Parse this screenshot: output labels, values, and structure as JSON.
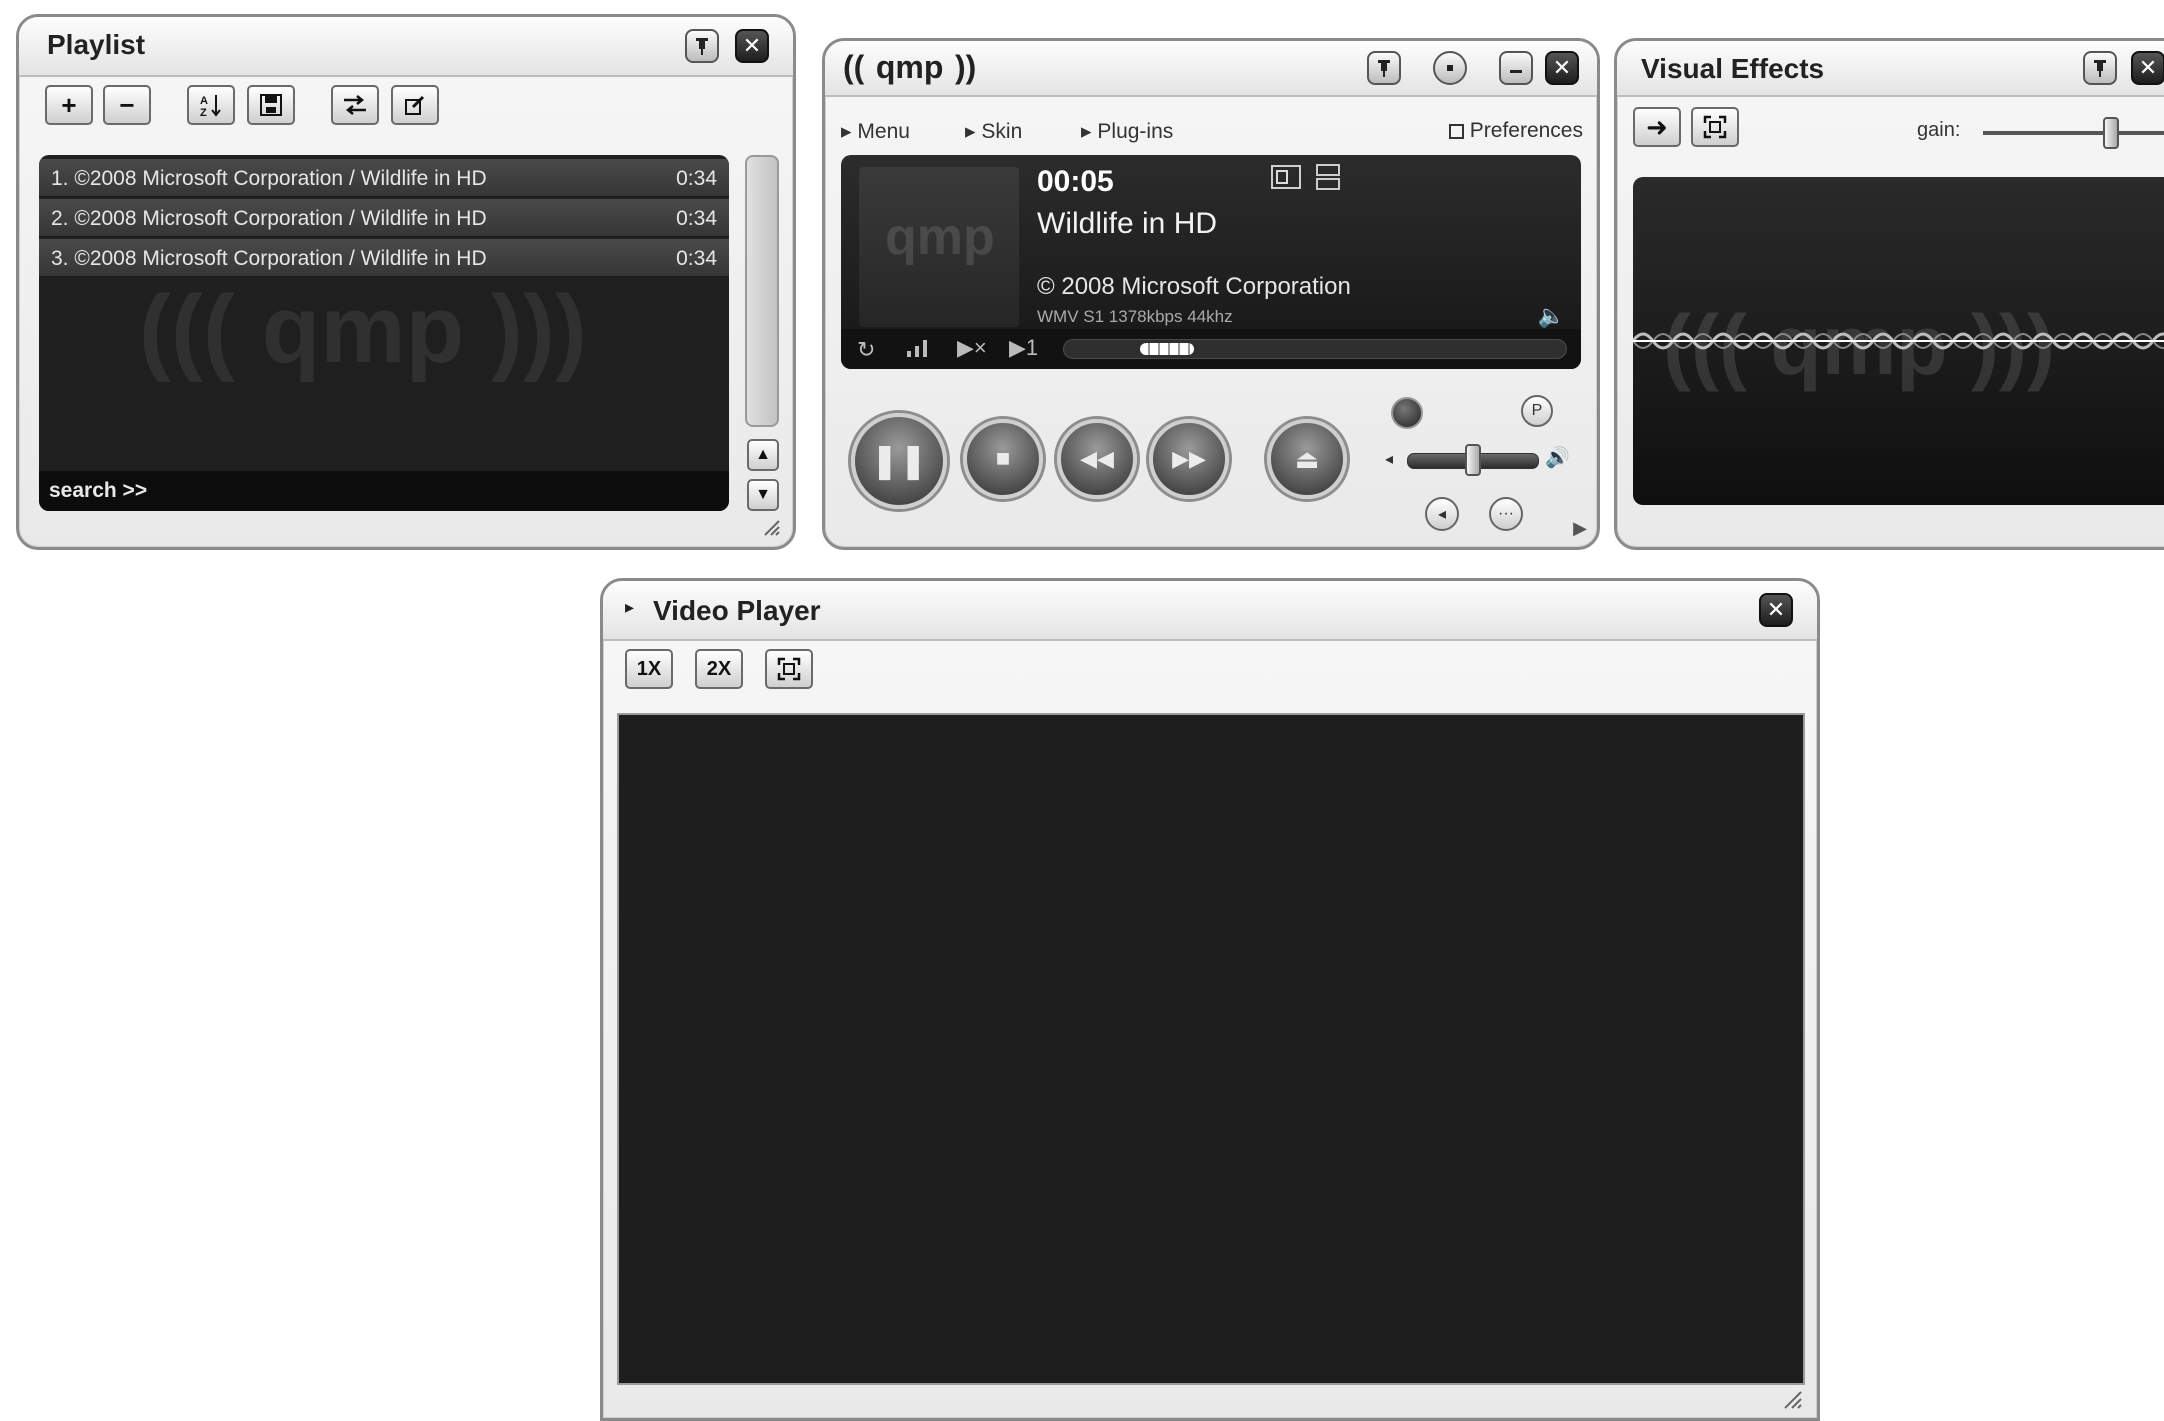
{
  "playlist": {
    "title": "Playlist",
    "pin_icon": "pin-icon",
    "close_icon": "close-icon",
    "toolbar": {
      "add": "+",
      "remove": "−",
      "sort_icon": "sort-icon",
      "save_icon": "save-icon",
      "shuffle_icon": "shuffle-icon",
      "edit_icon": "edit-icon"
    },
    "items": [
      {
        "title": "1. ©2008 Microsoft Corporation / Wildlife in HD",
        "duration": "0:34"
      },
      {
        "title": "2. ©2008 Microsoft Corporation / Wildlife in HD",
        "duration": "0:34"
      },
      {
        "title": "3. ©2008 Microsoft Corporation / Wildlife in HD",
        "duration": "0:34"
      }
    ],
    "watermark": "((( qmp )))",
    "search_label": "search >>",
    "scroll_up": "▲",
    "scroll_down": "▼"
  },
  "main": {
    "logo": "((  qmp  ))",
    "menu": [
      {
        "label": "Menu"
      },
      {
        "label": "Skin"
      },
      {
        "label": "Plug-ins"
      }
    ],
    "preferences": "Preferences",
    "time": "00:05",
    "track_title": "Wildlife in HD",
    "artist": "© 2008 Microsoft Corporation",
    "format": "WMV  S1 1378kbps 44khz",
    "art_watermark": "qmp",
    "progress": 0.06,
    "volume": 0.5
  },
  "visual": {
    "title": "Visual Effects",
    "gain_label": "gain:",
    "gain": 0.65,
    "watermark": "((( qmp )))"
  },
  "video": {
    "title": "Video Player",
    "btn_1x": "1X",
    "btn_2x": "2X"
  }
}
